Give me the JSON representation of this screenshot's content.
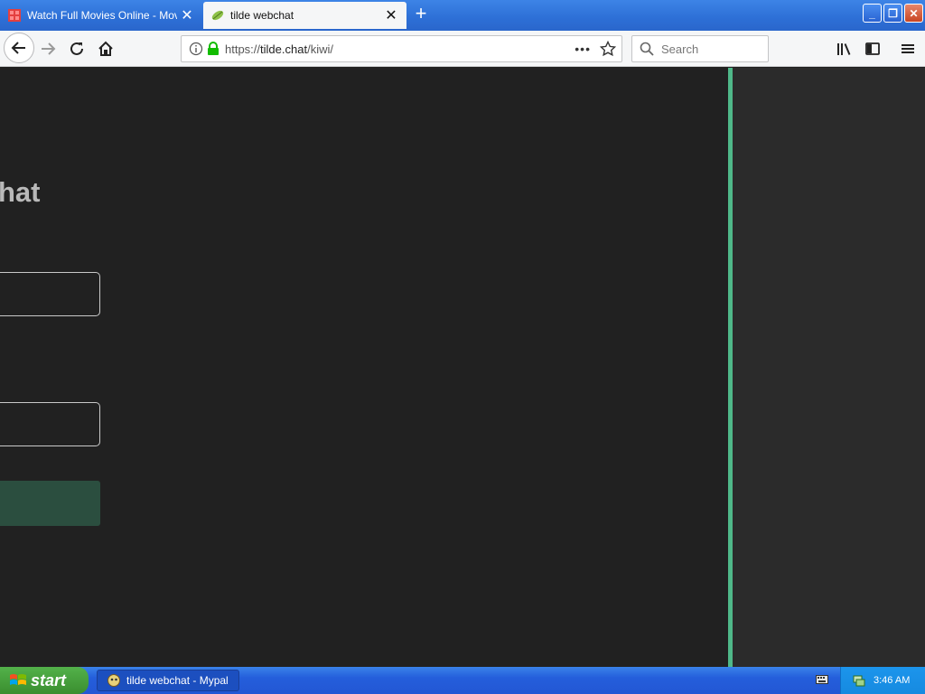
{
  "tabs": [
    {
      "title": "Watch Full Movies Online - MovieO",
      "active": false
    },
    {
      "title": "tilde webchat",
      "active": true
    }
  ],
  "nav": {
    "url_prefix": "https://",
    "url_host": "tilde.chat",
    "url_path": "/kiwi/",
    "search_placeholder": "Search"
  },
  "page": {
    "title_fragment": "hat"
  },
  "taskbar": {
    "start_label": "start",
    "task_label": "tilde webchat - Mypal",
    "clock": "3:46 AM"
  },
  "colors": {
    "page_bg": "#212121",
    "accent_divider": "#4fb889",
    "submit_button": "#2b4e3f",
    "side_panel": "#2b2b2b"
  }
}
